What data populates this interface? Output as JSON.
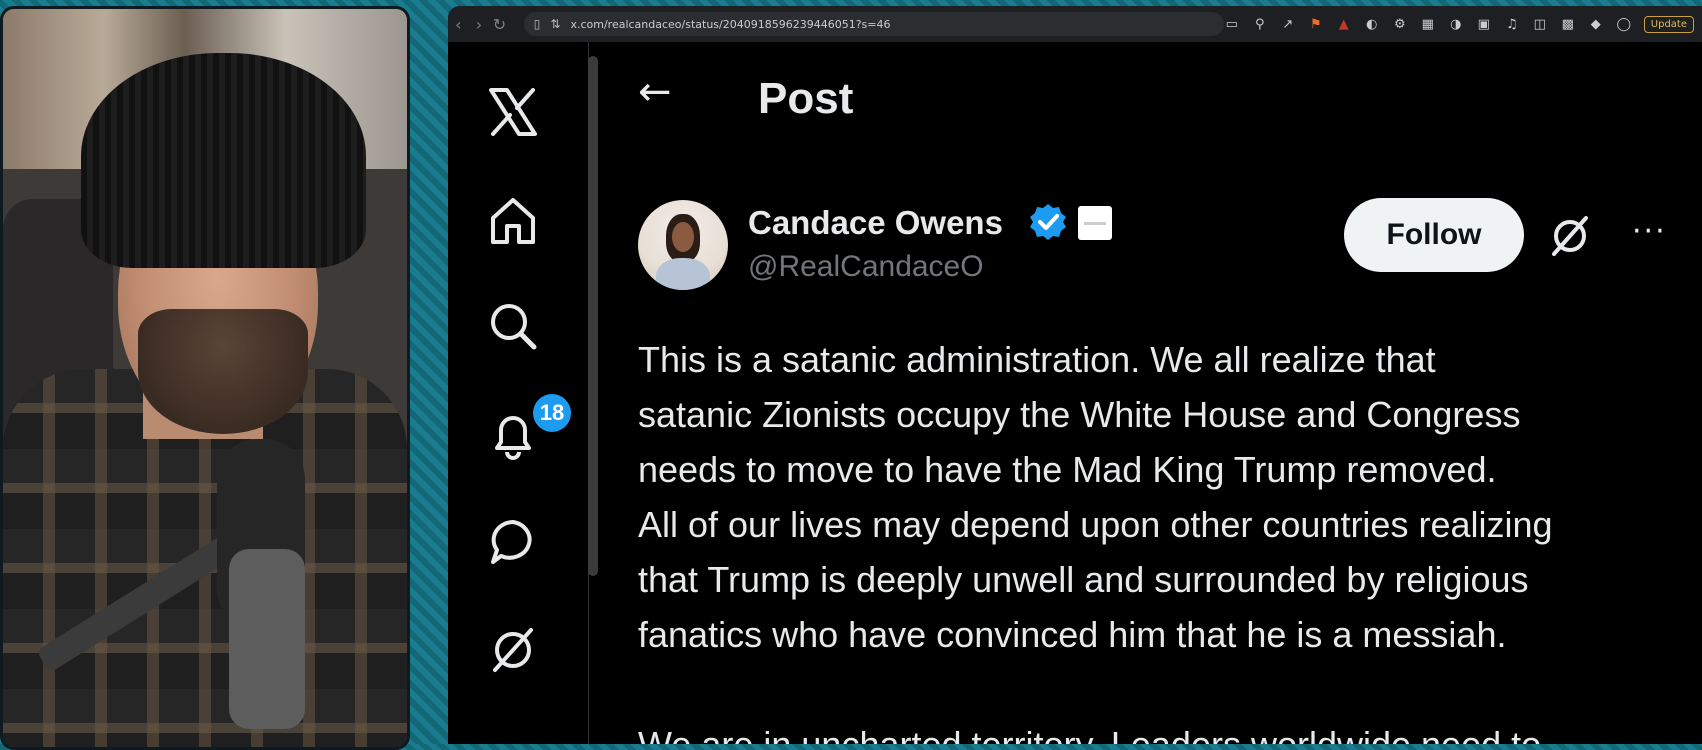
{
  "browser": {
    "url": "x.com/realcandaceo/status/2040918596239446051?s=46",
    "update_label": "Update"
  },
  "sidebar": {
    "notifications_count": "18"
  },
  "header": {
    "title": "Post"
  },
  "post": {
    "author_name": "Candace Owens",
    "handle": "@RealCandaceO",
    "follow_label": "Follow",
    "more_label": "···",
    "lines": [
      "This is a satanic administration. We all realize that",
      "satanic Zionists occupy the White House and Congress",
      "needs to move to have the Mad King Trump removed.",
      "All of our lives may depend upon other countries realizing",
      "that Trump is deeply unwell and surrounded by religious",
      "fanatics who have convinced him that he is a messiah."
    ],
    "partial_line": "We are in uncharted territory. Leaders worldwide need to"
  },
  "colors": {
    "accent": "#1d9bf0",
    "background": "#000000",
    "text": "#e7e9ea",
    "muted": "#71767b"
  },
  "icons": [
    "x-logo-icon",
    "home-icon",
    "search-icon",
    "notifications-icon",
    "messages-icon",
    "grok-icon"
  ]
}
